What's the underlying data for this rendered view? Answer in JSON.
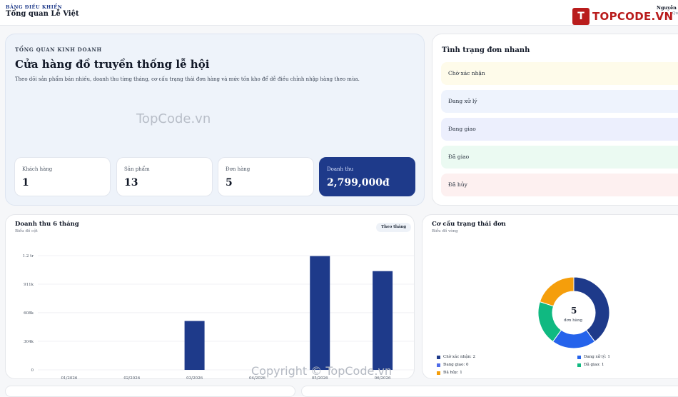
{
  "header": {
    "breadcrumb": "BẢNG ĐIỀU KHIỂN",
    "title": "Tổng quan Lễ Việt",
    "logo_mark": "T",
    "logo_text": "TOPCODE.VN",
    "user_name": "Nguyễn Q",
    "user_role": "Qu"
  },
  "hero": {
    "eyebrow": "TỔNG QUAN KINH DOANH",
    "title": "Cửa hàng đồ truyền thống lễ hội",
    "description": "Theo dõi sản phẩm bán nhiều, doanh thu từng tháng, cơ cấu trạng thái đơn hàng và mức tồn kho để dễ điều chỉnh nhập hàng theo mùa.",
    "watermark": "TopCode.vn",
    "stats": [
      {
        "label": "Khách hàng",
        "value": "1"
      },
      {
        "label": "Sản phẩm",
        "value": "13"
      },
      {
        "label": "Đơn hàng",
        "value": "5"
      },
      {
        "label": "Doanh thu",
        "value": "2,799,000đ"
      }
    ]
  },
  "order_status": {
    "title": "Tình trạng đơn nhanh",
    "rows": [
      {
        "label": "Chờ xác nhận",
        "color": "#fefbea"
      },
      {
        "label": "Đang xử lý",
        "color": "#eef3fd"
      },
      {
        "label": "Đang giao",
        "color": "#eceffd"
      },
      {
        "label": "Đã giao",
        "color": "#ebfaf2"
      },
      {
        "label": "Đã hủy",
        "color": "#fdf0f0"
      }
    ]
  },
  "revenue_chart": {
    "title": "Doanh thu 6 tháng",
    "subtitle": "Biểu đồ cột",
    "toggle": "Theo tháng"
  },
  "donut_chart": {
    "title": "Cơ cấu trạng thái đơn",
    "subtitle": "Biểu đồ vòng",
    "center_value": "5",
    "center_label": "đơn hàng"
  },
  "footer": {
    "copyright": "Copyright © TopCode.vn"
  },
  "chart_data": [
    {
      "type": "bar",
      "title": "Doanh thu 6 tháng",
      "categories": [
        "01/2026",
        "02/2026",
        "03/2026",
        "04/2026",
        "05/2026",
        "06/2026"
      ],
      "tick_labels": [
        "0",
        "304k",
        "608k",
        "911k",
        "1.2 tr"
      ],
      "tick_values": [
        0,
        304000,
        608000,
        911000,
        1215000
      ],
      "values": [
        0,
        0,
        520000,
        0,
        1210000,
        1050000
      ],
      "ylim": [
        0,
        1215000
      ],
      "grid": true,
      "color": "#1e3a8a"
    },
    {
      "type": "pie",
      "title": "Cơ cấu trạng thái đơn",
      "labels": [
        "Chờ xác nhận",
        "Đang xử lý",
        "Đang giao",
        "Đã giao",
        "Đã hủy"
      ],
      "values": [
        2,
        1,
        0,
        1,
        1
      ],
      "colors": [
        "#1e3a8a",
        "#2563eb",
        "#4f6be8",
        "#10b981",
        "#f59e0b"
      ],
      "legend": [
        "Chờ xác nhận: 2",
        "Đang xử lý: 1",
        "Đang giao: 0",
        "Đã giao: 1",
        "Đã hủy: 1"
      ],
      "legend_position": "bottom"
    }
  ]
}
